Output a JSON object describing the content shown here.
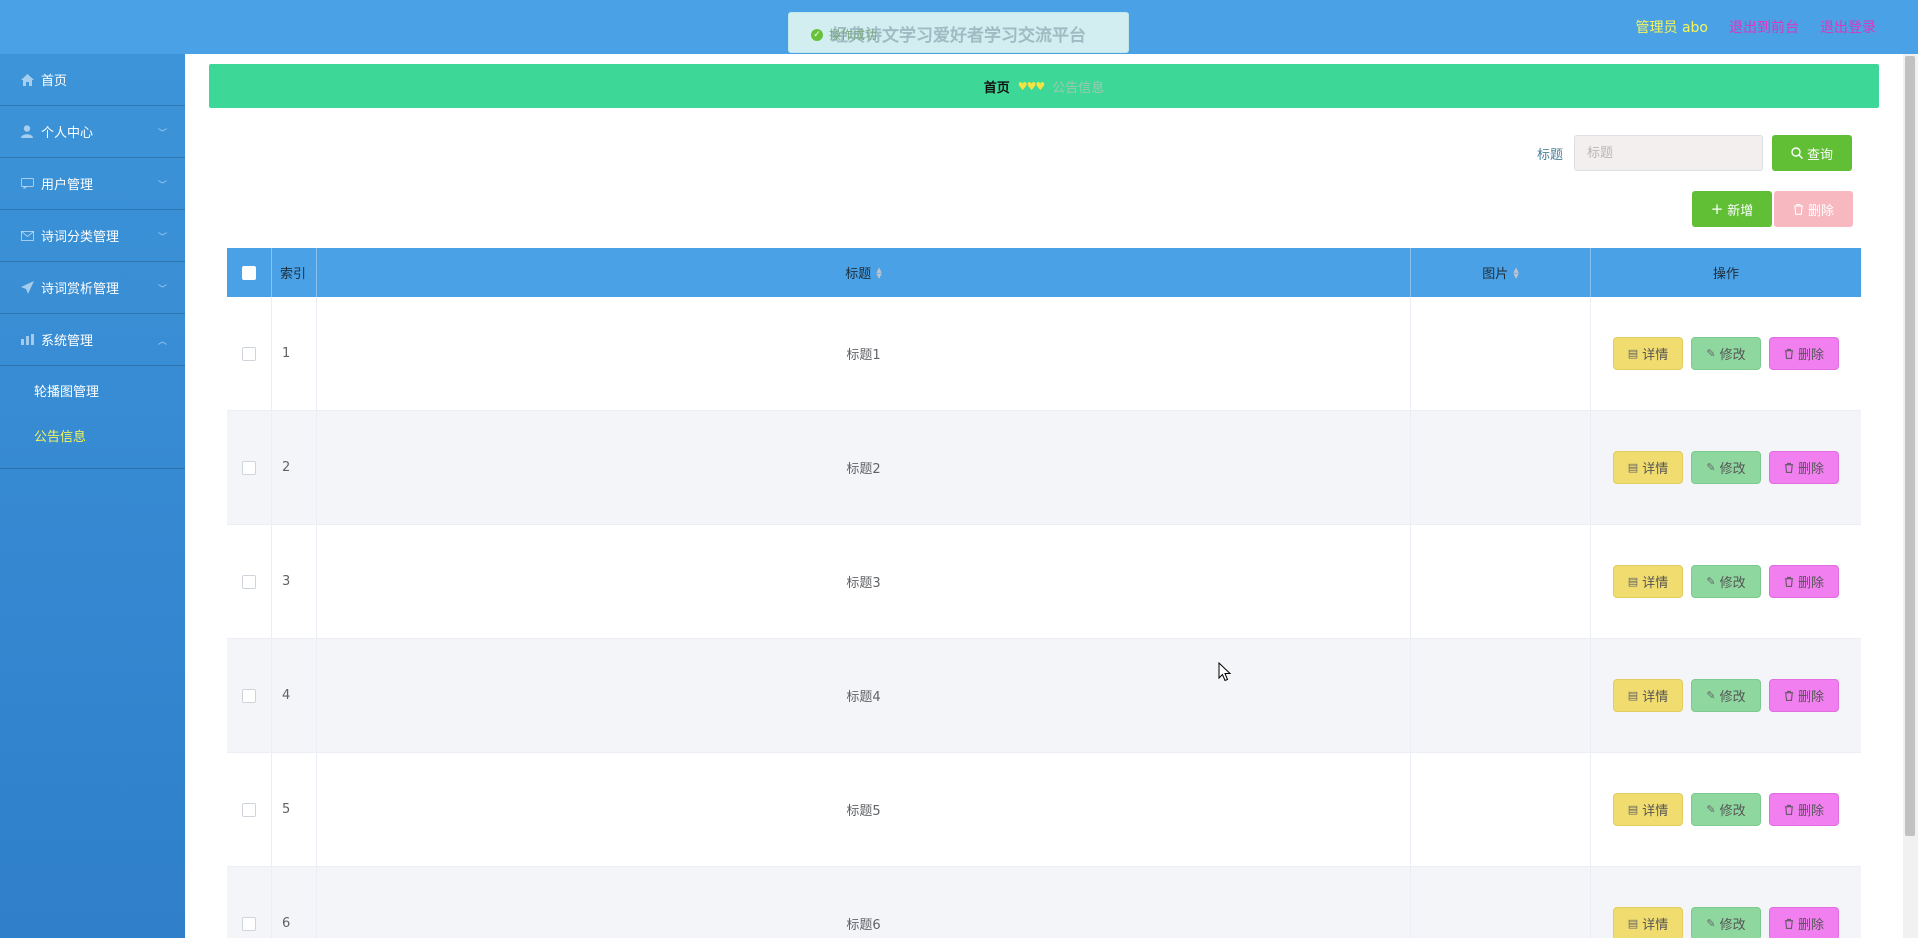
{
  "header": {
    "title": "经典诗文学习爱好者学习交流平台",
    "user": "管理员 abo",
    "links": [
      "退出到前台",
      "退出登录"
    ]
  },
  "toast": {
    "message": "操作成功"
  },
  "sidebar": {
    "items": [
      {
        "label": "首页",
        "icon": "home-icon"
      },
      {
        "label": "个人中心",
        "icon": "user-icon"
      },
      {
        "label": "用户管理",
        "icon": "message-icon"
      },
      {
        "label": "诗词分类管理",
        "icon": "mail-icon"
      },
      {
        "label": "诗词赏析管理",
        "icon": "send-icon"
      },
      {
        "label": "系统管理",
        "icon": "grid-icon"
      }
    ],
    "subitems": [
      "轮播图管理",
      "公告信息"
    ]
  },
  "breadcrumb": {
    "home": "首页",
    "separator": "♥♥♥",
    "current": "公告信息"
  },
  "search": {
    "label": "标题",
    "placeholder": "标题",
    "button": "查询"
  },
  "toolbar": {
    "add": "新增",
    "delete": "删除"
  },
  "table": {
    "columns": [
      "索引",
      "标题",
      "图片",
      "操作"
    ],
    "rows": [
      {
        "index": "1",
        "title": "标题1"
      },
      {
        "index": "2",
        "title": "标题2"
      },
      {
        "index": "3",
        "title": "标题3"
      },
      {
        "index": "4",
        "title": "标题4"
      },
      {
        "index": "5",
        "title": "标题5"
      },
      {
        "index": "6",
        "title": "标题6"
      }
    ],
    "actions": {
      "detail": "详情",
      "edit": "修改",
      "delete": "删除"
    }
  },
  "colors": {
    "header": "#4aa1e6",
    "sidebar": "#3d94d8",
    "breadcrumb": "#3dd898",
    "accent_yellow": "#f4f45d",
    "link_magenta": "#d838c0",
    "success_green": "#61bf36"
  }
}
